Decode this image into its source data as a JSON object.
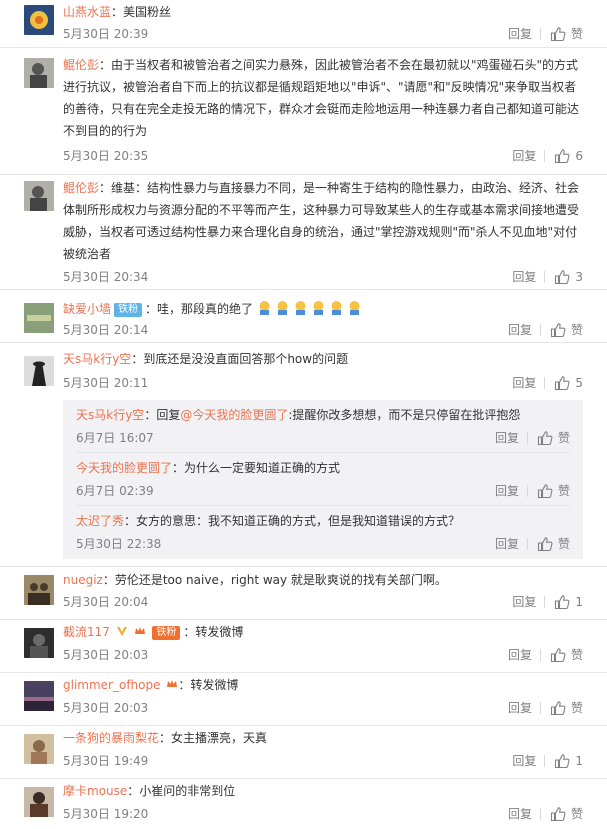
{
  "actions": {
    "reply": "回复",
    "like": "赞"
  },
  "comments": [
    {
      "user": "山燕水蓝",
      "text": "：美国粉丝",
      "time": "5月30日 20:39",
      "likes": "赞"
    },
    {
      "user": "鲲伦彭",
      "text": "：由于当权者和被管治者之间实力悬殊，因此被管治者不会在最初就以\"鸡蛋碰石头\"的方式进行抗议，被管治者自下而上的抗议都是循规蹈矩地以\"申诉\"、\"请愿\"和\"反映情况\"来争取当权者的善待，只有在完全走投无路的情况下，群众才会铤而走险地运用一种连暴力者自己都知道可能达不到目的的行为",
      "time": "5月30日 20:35",
      "likes": "6"
    },
    {
      "user": "鲲伦彭",
      "text": "：维基：结构性暴力与直接暴力不同，是一种寄生于结构的隐性暴力，由政治、经济、社会体制所形成权力与资源分配的不平等而产生，这种暴力可导致某些人的生存或基本需求间接地遭受威胁，当权者可透过结构性暴力来合理化自身的统治，通过\"掌控游戏规则\"而\"杀人不见血地\"对付被统治者",
      "time": "5月30日 20:34",
      "likes": "3"
    },
    {
      "user": "缺爱小墙",
      "badge": "铁粉",
      "text": "：哇，那段真的绝了",
      "time": "5月30日 20:14",
      "likes": "赞"
    },
    {
      "user": "天s马k行y空",
      "text": "：到底还是没没直面回答那个how的问题",
      "time": "5月30日 20:11",
      "likes": "5"
    },
    {
      "user": "nuegiz",
      "text": "：劳伦还是too naive，right way 就是耿爽说的找有关部门啊。",
      "time": "5月30日 20:04",
      "likes": "1"
    },
    {
      "user": "截流117",
      "badge": "铁粉",
      "text": "：转发微博",
      "time": "5月30日 20:03",
      "likes": "赞"
    },
    {
      "user": "glimmer_ofhope",
      "text": "：转发微博",
      "time": "5月30日 20:03",
      "likes": "赞"
    },
    {
      "user": "一条狗的暴雨梨花",
      "text": "：女主播漂亮，天真",
      "time": "5月30日 19:49",
      "likes": "1"
    },
    {
      "user": "摩卡mouse",
      "text": "：小崔问的非常到位",
      "time": "5月30日 19:20",
      "likes": "赞"
    }
  ],
  "replies": [
    {
      "user": "天s马k行y空",
      "text_prefix": "：回复",
      "mention": "@今天我的脸更圆了",
      "text": ":提醒你改多想想，而不是只停留在批评抱怨",
      "time": "6月7日 16:07",
      "likes": "赞"
    },
    {
      "user": "今天我的脸更圆了",
      "text": "：为什么一定要知道正确的方式",
      "time": "6月7日 02:39",
      "likes": "赞"
    },
    {
      "user": "太迟了秀",
      "text": "：女方的意思：我不知道正确的方式，但是我知道错误的方式？",
      "time": "5月30日 22:38",
      "likes": "赞"
    }
  ]
}
